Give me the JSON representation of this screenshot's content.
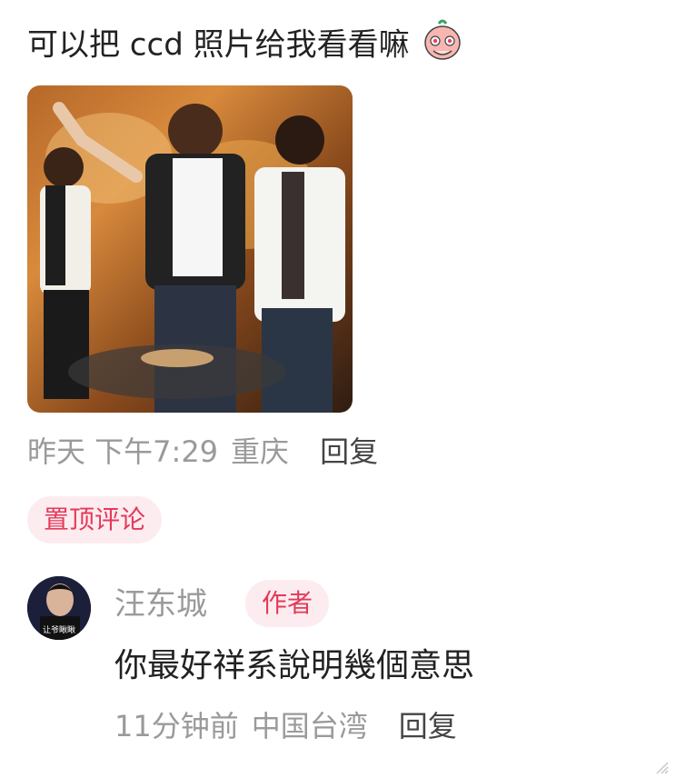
{
  "comment": {
    "text": "可以把 ccd 照片给我看看嘛",
    "emoji_icon": "cute-peach-face-emoji-icon",
    "photo_alt": "group photo",
    "time": "昨天 下午7:29",
    "location": "重庆",
    "reply_label": "回复",
    "pin_label": "置顶评论"
  },
  "reply": {
    "author": "汪东城",
    "author_badge": "作者",
    "avatar_text": "让爷瞅瞅",
    "text": "你最好祥系說明幾個意思",
    "time": "11分钟前",
    "location": "中国台湾",
    "reply_label": "回复"
  },
  "colors": {
    "accent": "#e33a5a",
    "badge_bg": "#fdecef",
    "meta_gray": "#9a9a9a"
  }
}
